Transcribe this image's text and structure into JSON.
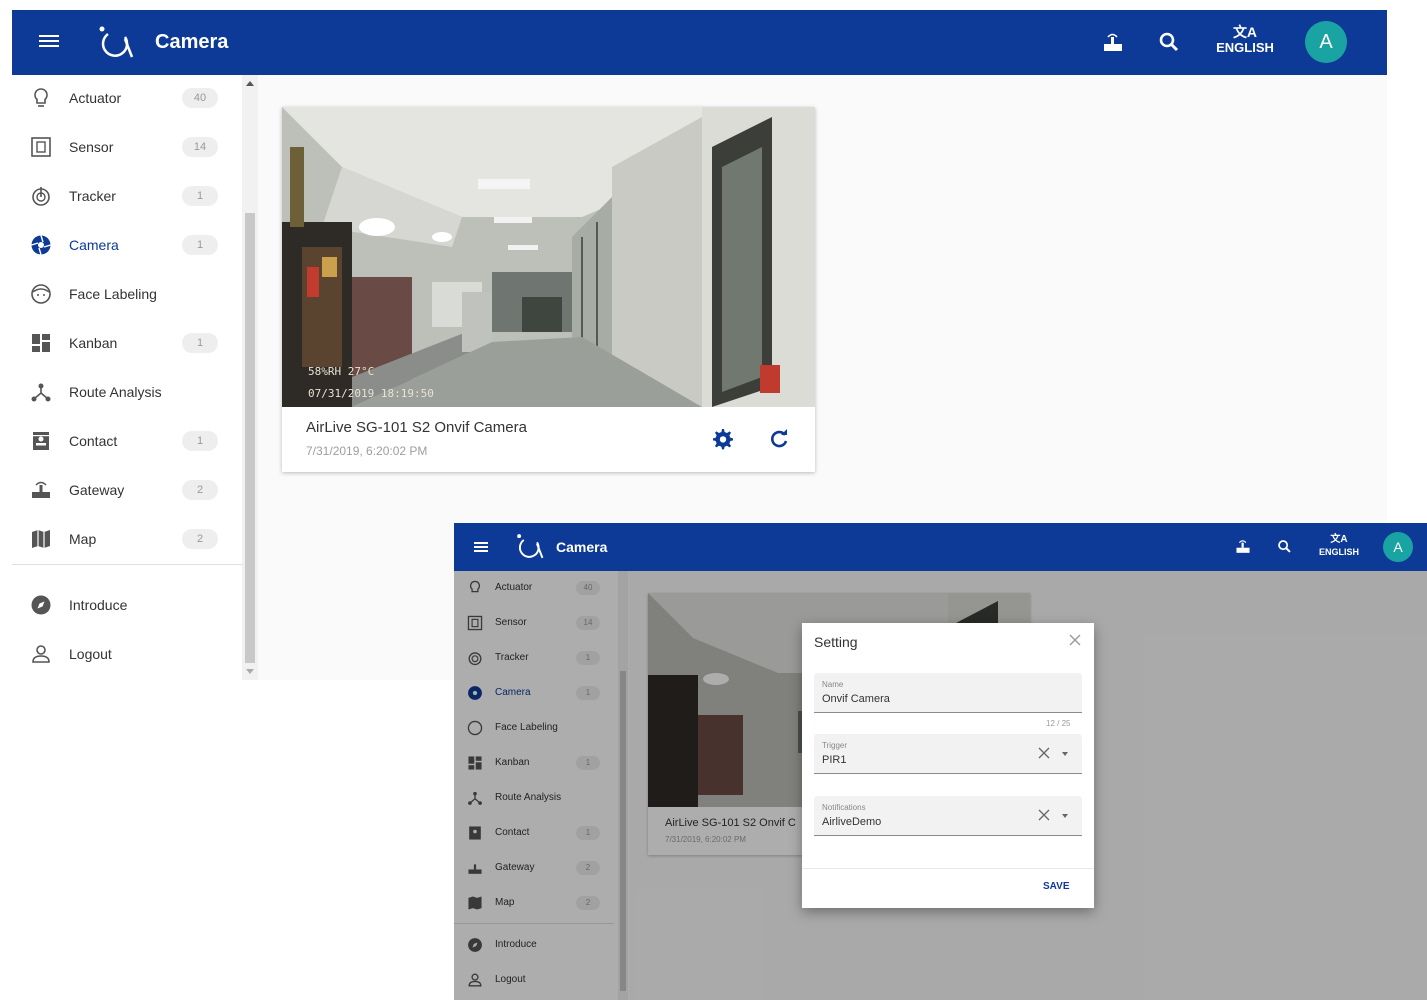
{
  "app": {
    "title": "Camera",
    "language": "ENGLISH",
    "avatar_initial": "A",
    "brand_color": "#0e3a97",
    "avatar_color": "#1aa3a3"
  },
  "sidebar": {
    "items": [
      {
        "label": "Actuator",
        "count": "40",
        "icon": "lightbulb-icon"
      },
      {
        "label": "Sensor",
        "count": "14",
        "icon": "sensor-icon"
      },
      {
        "label": "Tracker",
        "count": "1",
        "icon": "tracker-icon"
      },
      {
        "label": "Camera",
        "count": "1",
        "icon": "camera-aperture-icon",
        "active": true
      },
      {
        "label": "Face Labeling",
        "count": "",
        "icon": "face-icon"
      },
      {
        "label": "Kanban",
        "count": "1",
        "icon": "dashboard-icon"
      },
      {
        "label": "Route Analysis",
        "count": "",
        "icon": "route-icon"
      },
      {
        "label": "Contact",
        "count": "1",
        "icon": "contact-icon"
      },
      {
        "label": "Gateway",
        "count": "2",
        "icon": "gateway-icon"
      },
      {
        "label": "Map",
        "count": "2",
        "icon": "map-icon"
      }
    ],
    "footer": [
      {
        "label": "Introduce",
        "icon": "compass-icon"
      },
      {
        "label": "Logout",
        "icon": "user-icon"
      }
    ]
  },
  "camera_card": {
    "name": "AirLive SG-101 S2 Onvif Camera",
    "timestamp": "7/31/2019, 6:20:02 PM",
    "name_short": "AirLive SG-101 S2 Onvif C",
    "osd_line1": "58%RH   27°C",
    "osd_line2": "07/31/2019  18:19:50"
  },
  "dialog": {
    "title": "Setting",
    "fields": [
      {
        "label": "Name",
        "value": "Onvif Camera"
      },
      {
        "label": "Trigger",
        "value": "PIR1"
      },
      {
        "label": "Notifications",
        "value": "AirliveDemo"
      }
    ],
    "name_counter": "12 / 25",
    "save_label": "SAVE"
  }
}
